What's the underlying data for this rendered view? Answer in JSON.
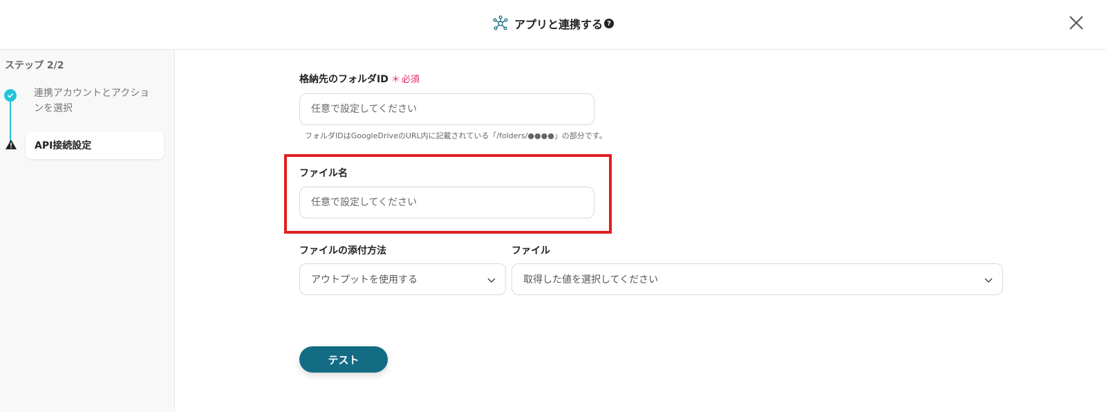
{
  "header": {
    "title": "アプリと連携する",
    "help": "?"
  },
  "sidebar": {
    "step_count": "ステップ 2/2",
    "steps": [
      {
        "label": "連携アカウントとアクションを選択",
        "status": "done"
      },
      {
        "label": "API接続設定",
        "status": "warning"
      }
    ]
  },
  "form": {
    "folder_id": {
      "label": "格納先のフォルダID",
      "required_mark": "＊",
      "required_text": "必須",
      "placeholder": "任意で設定してください",
      "hint": "フォルダIDはGoogleDriveのURL内に記載されている「/folders/●●●●」の部分です。"
    },
    "file_name": {
      "label": "ファイル名",
      "placeholder": "任意で設定してください"
    },
    "attach_method": {
      "label": "ファイルの添付方法",
      "value": "アウトプットを使用する"
    },
    "file": {
      "label": "ファイル",
      "value": "取得した値を選択してください"
    },
    "test_button": "テスト"
  },
  "colors": {
    "accent": "#22c3d8",
    "button": "#136b84",
    "highlight": "#e01e1e",
    "required": "#e0245e"
  }
}
